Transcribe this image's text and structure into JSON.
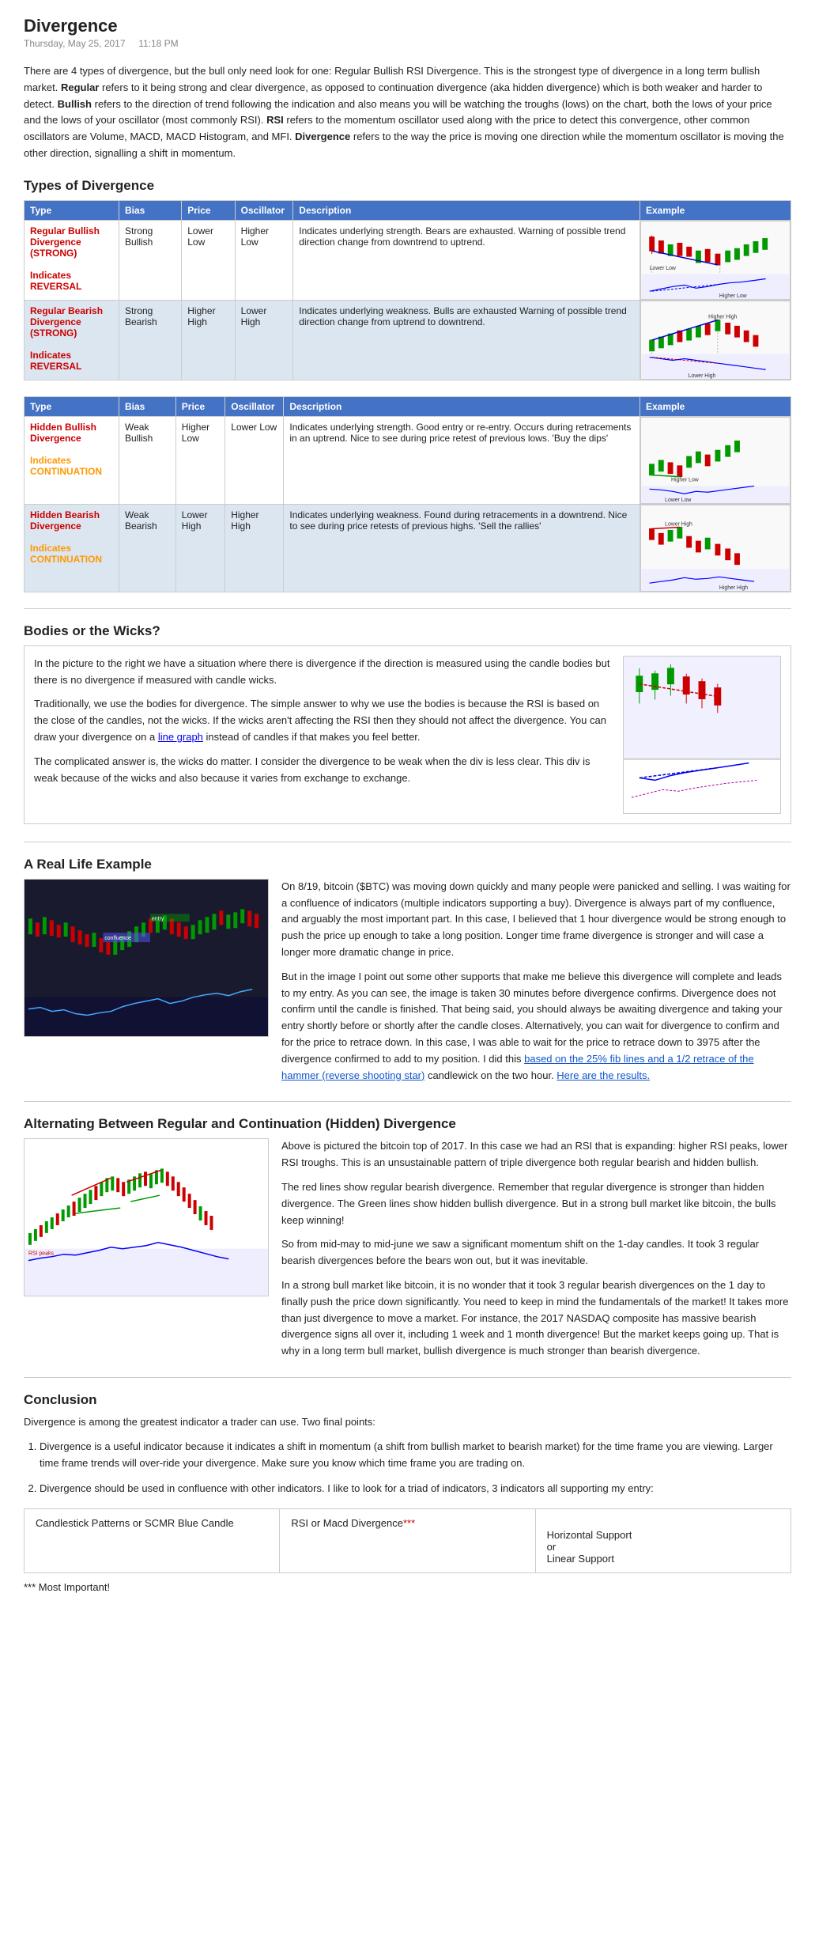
{
  "page": {
    "title": "Divergence",
    "date": "Thursday, May 25, 2017",
    "time": "11:18 PM"
  },
  "intro": {
    "p1": "There are 4 types of divergence, but the bull only need look for one: Regular Bullish RSI Divergence.  This is the strongest type of divergence in a long term bullish market.",
    "regular_label": "Regular",
    "regular_desc": "refers to it being strong and clear divergence, as opposed to continuation divergence (aka hidden divergence) which is both weaker and harder to detect.",
    "bullish_label": "Bullish",
    "bullish_desc": "refers to the direction of trend following the indication and also means you will be watching the troughs (lows) on the chart, both the lows of your price and the lows of your oscillator (most commonly RSI).",
    "rsi_label": "RSI",
    "rsi_desc": "refers to the momentum oscillator used along with the price to detect this convergence, other common oscillators are Volume, MACD, MACD Histogram, and MFI.",
    "divergence_label": "Divergence",
    "divergence_desc": "refers to the way the price is moving one direction while the momentum oscillator is moving the other direction, signalling a shift in momentum."
  },
  "types_section": {
    "heading": "Types of Divergence",
    "columns": [
      "Type",
      "Bias",
      "Price",
      "Oscillator",
      "Description",
      "Example"
    ],
    "rows": [
      {
        "type": "Regular Bullish Divergence (STRONG)\n\nIndicates REVERSAL",
        "type_color": "red",
        "bias": "Strong Bullish",
        "price": "Lower Low",
        "oscillator": "Higher Low",
        "description": "Indicates underlying strength. Bears are exhausted. Warning of possible trend direction change from downtrend to uptrend.",
        "example_type": "bullish_regular"
      },
      {
        "type": "Regular Bearish Divergence (STRONG)\n\nIndicates REVERSAL",
        "type_color": "red",
        "bias": "Strong Bearish",
        "price": "Higher High",
        "oscillator": "Lower High",
        "description": "Indicates underlying weakness. Bulls are exhausted Warning of possible trend direction change from uptrend to downtrend.",
        "example_type": "bearish_regular"
      }
    ],
    "rows2": [
      {
        "type": "Hidden Bullish Divergence\n\nIndicates CONTINUATION",
        "type_color": "continuation",
        "bias": "Weak Bullish",
        "price": "Higher Low",
        "oscillator": "Lower Low",
        "description": "Indicates underlying strength. Good entry or re-entry. Occurs during retracements in an uptrend. Nice to see during price retest of previous lows. 'Buy the dips'",
        "example_type": "hidden_bullish"
      },
      {
        "type": "Hidden Bearish Divergence\n\nIndicates CONTINUATION",
        "type_color": "continuation",
        "bias": "Weak Bearish",
        "price": "Lower High",
        "oscillator": "Higher High",
        "description": "Indicates underlying weakness. Found during retracements in a downtrend. Nice to see during price retests of previous highs. 'Sell the rallies'",
        "example_type": "hidden_bearish"
      }
    ]
  },
  "bodies_section": {
    "heading": "Bodies or the Wicks?",
    "p1": "In the picture to the right we have a situation where there is divergence if the direction is measured using the candle bodies but there is no divergence if measured with candle wicks.",
    "p2": "Traditionally, we use the bodies for divergence. The simple answer to why we use the bodies is because the RSI is based on the close of the candles, not the wicks. If the wicks aren't affecting the RSI then they should not affect the divergence. You can draw your divergence on a line graph instead of candles if that makes you feel better.",
    "p3": "The complicated answer is, the wicks do matter. I consider the divergence to be weak when the div is less clear. This div is weak because of the wicks and also because it varies from exchange to exchange.",
    "link_text": "line graph"
  },
  "reallife_section": {
    "heading": "A Real Life Example",
    "text1": "On 8/19, bitcoin ($BTC) was moving down quickly and many people were panicked and selling.  I was waiting for a confluence of indicators (multiple indicators supporting a buy).  Divergence is always part of my confluence, and arguably the most important part.  In this case, I believed that 1 hour divergence would be strong enough to push the price up enough to take a long position.  Longer time frame divergence is stronger and will case a longer more dramatic change in price.",
    "text2": "But in the image I point out some other supports that make me believe this divergence will complete and leads to my entry.  As you can see, the image is taken 30 minutes before divergence confirms.  Divergence does not confirm until the candle is finished.  That being said, you should always be awaiting divergence and taking your entry shortly before or shortly after the candle closes.  Alternatively, you can wait for divergence to confirm and for the price to retrace down.  In this case, I was able to wait for the price to retrace down to 3975 after the divergence confirmed to add to my position.  I did this",
    "link1_text": "based on the 25% fib lines and a 1/2 retrace of the hammer (reverse shooting star)",
    "text3": "candlewick on the two hour.",
    "link2_text": "Here are the results."
  },
  "alternating_section": {
    "heading": "Alternating Between Regular and Continuation (Hidden) Divergence",
    "text1": "Above is pictured the bitcoin top of 2017.  In this case we had an RSI that is expanding: higher RSI peaks, lower RSI troughs.  This is an unsustainable pattern of triple divergence both regular bearish and hidden bullish.",
    "text2": "The red lines show regular bearish divergence.  Remember that regular divergence is stronger than hidden divergence.  The Green lines show hidden bullish divergence.  But in a strong bull market like bitcoin, the bulls keep winning!",
    "text3": "So from mid-may to mid-june we saw a significant momentum shift on the 1-day candles.  It took 3 regular bearish divergences before the bears won out, but it was inevitable.",
    "text4": "In a strong bull market like bitcoin, it is no wonder that it took 3 regular bearish divergences on the 1 day to finally push the price down significantly.  You need to keep in mind the fundamentals of the market!  It takes more than just divergence to move a market.  For instance, the 2017 NASDAQ composite has massive bearish divergence signs all over it, including 1 week and 1 month divergence!  But the market keeps going up.  That is why in a long term bull market, bullish divergence is much stronger than bearish divergence."
  },
  "conclusion_section": {
    "heading": "Conclusion",
    "intro": "Divergence is among the greatest indicator a trader can use.  Two final points:",
    "points": [
      "Divergence is a useful indicator because it indicates a shift in momentum (a shift from bullish market to bearish market) for the time frame you are viewing.  Larger time frame trends will over-ride your divergence.  Make sure you know which time frame you are trading on.",
      "Divergence should be used in confluence with other indicators.  I like to look for a triad of indicators, 3 indicators all supporting my entry:"
    ]
  },
  "bottom_table": {
    "col1_header": "Candlestick Patterns or SCMR Blue Candle",
    "col2_header": "RSI or Macd Divergence***",
    "col3_header": "Horizontal Support\nor\nLinear Support",
    "most_important": "*** Most Important!",
    "asterisk_note": "***"
  }
}
